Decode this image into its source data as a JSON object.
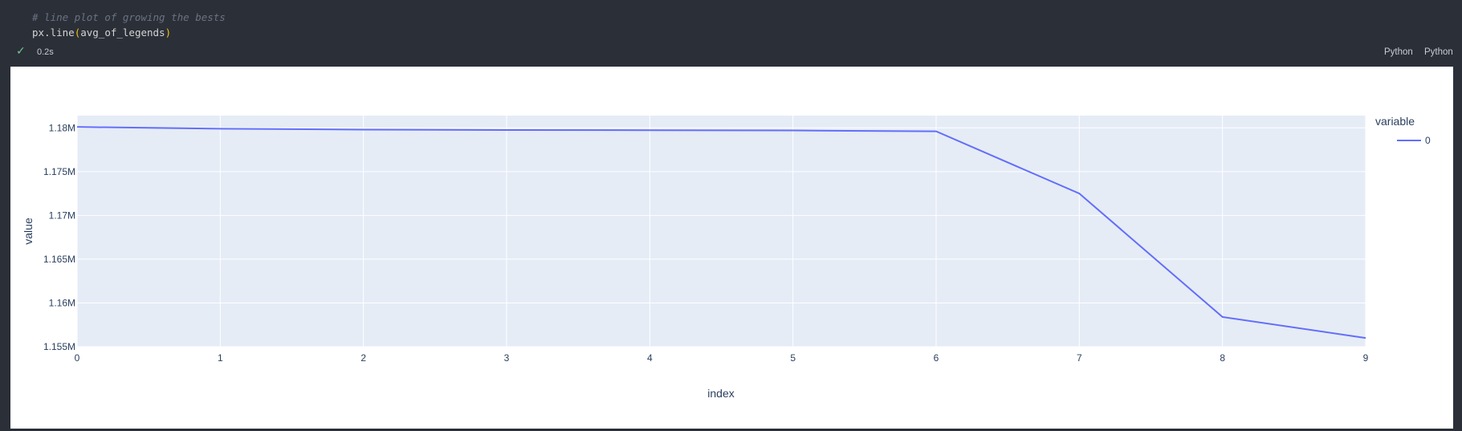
{
  "code": {
    "comment": "# line plot of growing the bests",
    "call_fn": "px.line",
    "call_open": "(",
    "call_arg": "avg_of_legends",
    "call_close": ")"
  },
  "status": {
    "check_icon": "check-icon",
    "elapsed": "0.2s",
    "kernel_label_1": "Python",
    "kernel_label_2": "Python"
  },
  "colors": {
    "editor_bg": "#2b2f38",
    "plot_bg": "#e5ecf6",
    "line": "#636efa",
    "success": "#73c991"
  },
  "chart_data": {
    "type": "line",
    "x": [
      0,
      1,
      2,
      3,
      4,
      5,
      6,
      7,
      8,
      9
    ],
    "series": [
      {
        "name": "0",
        "values": [
          1180100,
          1179900,
          1179800,
          1179750,
          1179730,
          1179700,
          1179600,
          1172500,
          1158400,
          1156000
        ]
      }
    ],
    "xlabel": "index",
    "ylabel": "value",
    "legend_title": "variable",
    "xlim": [
      0,
      9
    ],
    "ylim": [
      1155000,
      1181400
    ],
    "xticks": [
      "0",
      "1",
      "2",
      "3",
      "4",
      "5",
      "6",
      "7",
      "8",
      "9"
    ],
    "yticks": [
      {
        "value": 1155000,
        "label": "1.155M"
      },
      {
        "value": 1160000,
        "label": "1.16M"
      },
      {
        "value": 1165000,
        "label": "1.165M"
      },
      {
        "value": 1170000,
        "label": "1.17M"
      },
      {
        "value": 1175000,
        "label": "1.175M"
      },
      {
        "value": 1180000,
        "label": "1.18M"
      }
    ],
    "grid": true,
    "legend_position": "top-right"
  }
}
